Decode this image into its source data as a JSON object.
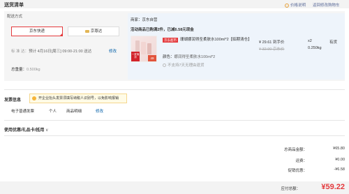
{
  "header": {
    "title": "送货清单",
    "price_note": "价格说明",
    "back_to_cart": "返回修改购物车"
  },
  "shipping": {
    "label": "配送方式",
    "options": [
      "京东快递",
      "京尊达"
    ],
    "standard_label": "标 准 达：",
    "standard_value": "预计 4月16日[周三] 09:00-21:00 送达",
    "modify": "修改",
    "weight_label": "总重量：",
    "weight_value": "0.500kg"
  },
  "seller": {
    "label": "商家：京东自营",
    "promo": "活动商品已购满2件，已减6.58元现金"
  },
  "product": {
    "badge": "京东超市",
    "thumb_text": "一夏清凉",
    "thumb_tag": "49",
    "name": "珊瑚娜润得圣柔肤水100ml*2【临期清仓】",
    "color_label": "颜色：",
    "color_value": "娜润得圣柔肤水100ml*2",
    "no_return": "不支持7天无理由退货",
    "price": "¥ 29.61 到手价",
    "old_price": "¥ 32.90 京东价",
    "qty": "x2",
    "weight": "0.250kg",
    "stock": "有货"
  },
  "invoice": {
    "title": "发票信息",
    "tip": "开企业抬头发票须填写纳税人识别号，以免影响报销",
    "type": "电子普通发票",
    "person": "个人",
    "detail": "商品明细",
    "modify": "修改"
  },
  "coupon": {
    "title": "使用优惠/礼品卡/抵用",
    "chevron": "∨"
  },
  "summary": {
    "total_label": "总商品金额：",
    "total_value": "¥65.80",
    "freight_label": "运费：",
    "freight_value": "¥0.00",
    "discount_label": "促销优惠：",
    "discount_value": "-¥6.58",
    "pay_label": "应付总额：",
    "pay_value": "¥59.22"
  },
  "colors": {
    "accent": "#e4393c",
    "link": "#005ea7"
  }
}
